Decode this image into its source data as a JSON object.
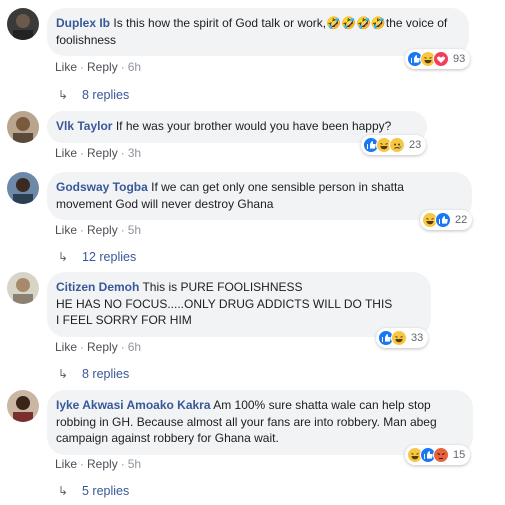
{
  "comments": [
    {
      "author": "Duplex Ib",
      "text": "Is this how the spirit of God talk or work,🤣🤣🤣🤣the voice of foolishness",
      "like": "Like",
      "reply": "Reply",
      "time": "6h",
      "reaction_count": "93",
      "replies": "8 replies"
    },
    {
      "author": "Vlk Taylor",
      "text": "If he was your brother would you have been happy?",
      "like": "Like",
      "reply": "Reply",
      "time": "3h",
      "reaction_count": "23"
    },
    {
      "author": "Godsway Togba",
      "text": "If we can get only one sensible person in shatta movement God will never destroy Ghana",
      "like": "Like",
      "reply": "Reply",
      "time": "5h",
      "reaction_count": "22",
      "replies": "12 replies"
    },
    {
      "author": "Citizen Demoh",
      "text_lines": [
        "This is PURE FOOLISHNESS",
        "HE HAS NO FOCUS.....ONLY DRUG ADDICTS WILL DO THIS",
        "I FEEL SORRY FOR HIM"
      ],
      "like": "Like",
      "reply": "Reply",
      "time": "6h",
      "reaction_count": "33",
      "replies": "8 replies"
    },
    {
      "author": "Iyke Akwasi Amoako Kakra",
      "text": "Am 100% sure shatta wale can help stop robbing in GH. Because almost all your fans are into robbery. Man abeg campaign against robbery for Ghana wait.",
      "like": "Like",
      "reply": "Reply",
      "time": "5h",
      "reaction_count": "15",
      "replies": "5 replies"
    }
  ],
  "icons": {
    "reply_arrow": "reply-arrow-icon",
    "reactions": [
      "like-reaction-icon",
      "haha-reaction-icon",
      "love-reaction-icon",
      "sad-reaction-icon",
      "angry-reaction-icon"
    ]
  },
  "colors": {
    "author": "#385898",
    "bubble": "#f2f3f5",
    "like": "#1877f2",
    "love": "#f33e58",
    "haha": "#f7c744"
  }
}
